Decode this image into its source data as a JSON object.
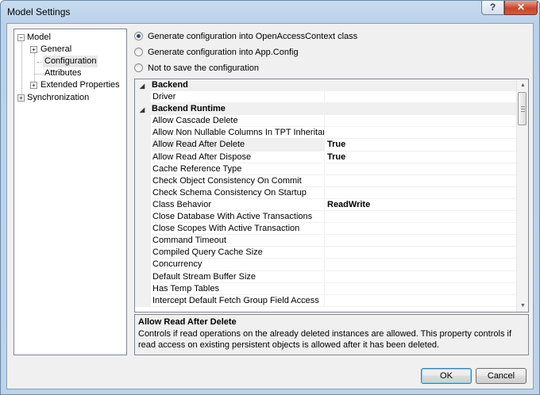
{
  "window": {
    "title": "Model Settings",
    "help_label": "?",
    "close_label": "✕"
  },
  "tree": {
    "model": "Model",
    "general": "General",
    "configuration": "Configuration",
    "attributes": "Attributes",
    "extended_properties": "Extended Properties",
    "synchronization": "Synchronization",
    "collapse_glyph": "−",
    "expand_glyph": "+"
  },
  "radios": [
    {
      "label": "Generate configuration into OpenAccessContext class",
      "checked": true
    },
    {
      "label": "Generate configuration into App.Config",
      "checked": false
    },
    {
      "label": "Not to save the configuration",
      "checked": false
    }
  ],
  "property_grid": {
    "rows": [
      {
        "kind": "category",
        "name": "Backend"
      },
      {
        "kind": "property",
        "name": "Driver",
        "value": ""
      },
      {
        "kind": "category",
        "name": "Backend Runtime"
      },
      {
        "kind": "property",
        "name": "Allow Cascade Delete",
        "value": ""
      },
      {
        "kind": "property",
        "name": "Allow Non Nullable Columns In TPT Inheritance",
        "value": ""
      },
      {
        "kind": "property",
        "name": "Allow Read After Delete",
        "value": "True",
        "selected": true
      },
      {
        "kind": "property",
        "name": "Allow Read After Dispose",
        "value": "True"
      },
      {
        "kind": "property",
        "name": "Cache Reference Type",
        "value": ""
      },
      {
        "kind": "property",
        "name": "Check Object Consistency On Commit",
        "value": ""
      },
      {
        "kind": "property",
        "name": "Check Schema Consistency On Startup",
        "value": ""
      },
      {
        "kind": "property",
        "name": "Class Behavior",
        "value": "ReadWrite"
      },
      {
        "kind": "property",
        "name": "Close Database With Active Transactions",
        "value": ""
      },
      {
        "kind": "property",
        "name": "Close Scopes With Active Transaction",
        "value": ""
      },
      {
        "kind": "property",
        "name": "Command Timeout",
        "value": ""
      },
      {
        "kind": "property",
        "name": "Compiled Query Cache Size",
        "value": ""
      },
      {
        "kind": "property",
        "name": "Concurrency",
        "value": ""
      },
      {
        "kind": "property",
        "name": "Default Stream Buffer Size",
        "value": ""
      },
      {
        "kind": "property",
        "name": "Has Temp Tables",
        "value": ""
      },
      {
        "kind": "property",
        "name": "Intercept Default Fetch Group Field Access",
        "value": ""
      }
    ],
    "collapse_glyph": "◢",
    "scroll_up": "▲",
    "scroll_down": "▼"
  },
  "description": {
    "title": "Allow Read After Delete",
    "text": "Controls if read operations on the already deleted instances are allowed. This property controls if read access on existing persistent objects is allowed after it has been deleted."
  },
  "buttons": {
    "ok": "OK",
    "cancel": "Cancel"
  }
}
